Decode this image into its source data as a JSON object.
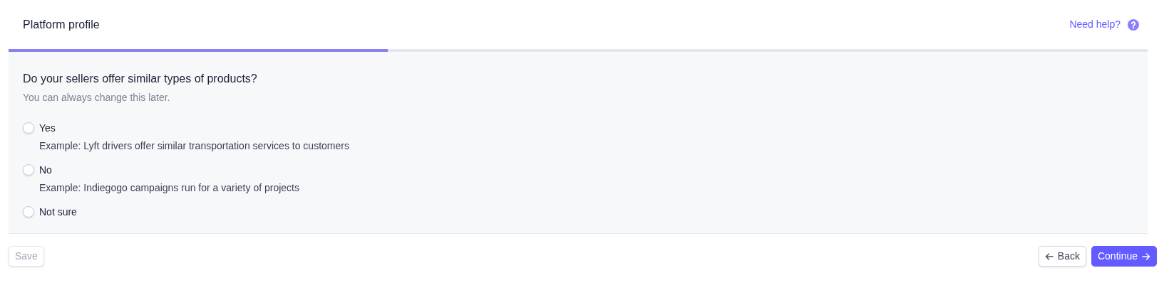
{
  "header": {
    "title": "Platform profile",
    "help_link": "Need help?"
  },
  "progress": {
    "level": 0.333
  },
  "question": {
    "title": "Do your sellers offer similar types of products?",
    "subtitle": "You can always change this later."
  },
  "options": [
    {
      "label": "Yes",
      "description": "Example: Lyft drivers offer similar transportation services to customers",
      "selected": false
    },
    {
      "label": "No",
      "description": "Example: Indiegogo campaigns run for a variety of projects",
      "selected": false
    },
    {
      "label": "Not sure",
      "selected": false
    }
  ],
  "footer": {
    "save": {
      "label": "Save",
      "disabled": true
    },
    "back": "Back",
    "continue": "Continue"
  }
}
